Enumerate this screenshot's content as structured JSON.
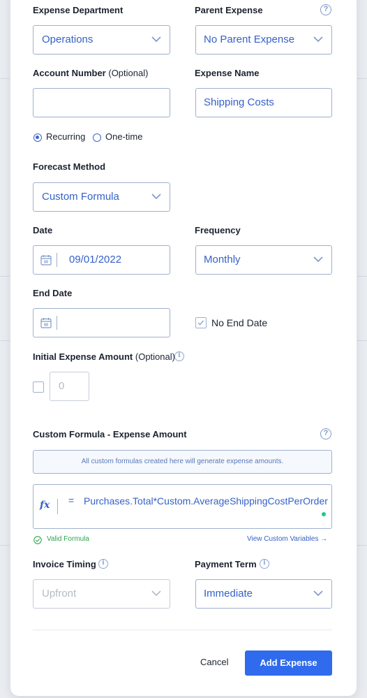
{
  "form": {
    "expense_department": {
      "label": "Expense Department",
      "value": "Operations"
    },
    "parent_expense": {
      "label": "Parent Expense",
      "value": "No Parent Expense"
    },
    "account_number": {
      "label": "Account Number",
      "optional": "(Optional)",
      "value": ""
    },
    "expense_name": {
      "label": "Expense Name",
      "value": "Shipping Costs"
    },
    "recurrence": {
      "options": [
        "Recurring",
        "One-time"
      ],
      "selected": "Recurring"
    },
    "forecast_method": {
      "label": "Forecast Method",
      "value": "Custom Formula"
    },
    "date": {
      "label": "Date",
      "value": "09/01/2022"
    },
    "frequency": {
      "label": "Frequency",
      "value": "Monthly"
    },
    "end_date": {
      "label": "End Date",
      "value": "",
      "no_end_date_label": "No End Date",
      "no_end_date_checked": true
    },
    "initial_amount": {
      "label": "Initial Expense Amount",
      "optional": "(Optional)",
      "placeholder": "0",
      "checked": false
    },
    "custom_formula": {
      "label": "Custom Formula - Expense Amount",
      "note": "All custom formulas created here will generate expense amounts.",
      "equals": "=",
      "formula": "Purchases.Total*Custom.AverageShippingCostPerOrder",
      "valid_text": "Valid Formula",
      "view_variables": "View Custom Variables →"
    },
    "invoice_timing": {
      "label": "Invoice Timing",
      "value": "Upfront"
    },
    "payment_term": {
      "label": "Payment Term",
      "value": "Immediate"
    }
  },
  "actions": {
    "cancel": "Cancel",
    "submit": "Add Expense"
  },
  "icons": [
    "help-icon",
    "info-icon",
    "calendar-icon",
    "chevron-down-icon",
    "checkmark-icon",
    "fx-icon"
  ],
  "colors": {
    "accent": "#2f6bec",
    "value_text": "#3561c8",
    "valid": "#2ea44f"
  }
}
